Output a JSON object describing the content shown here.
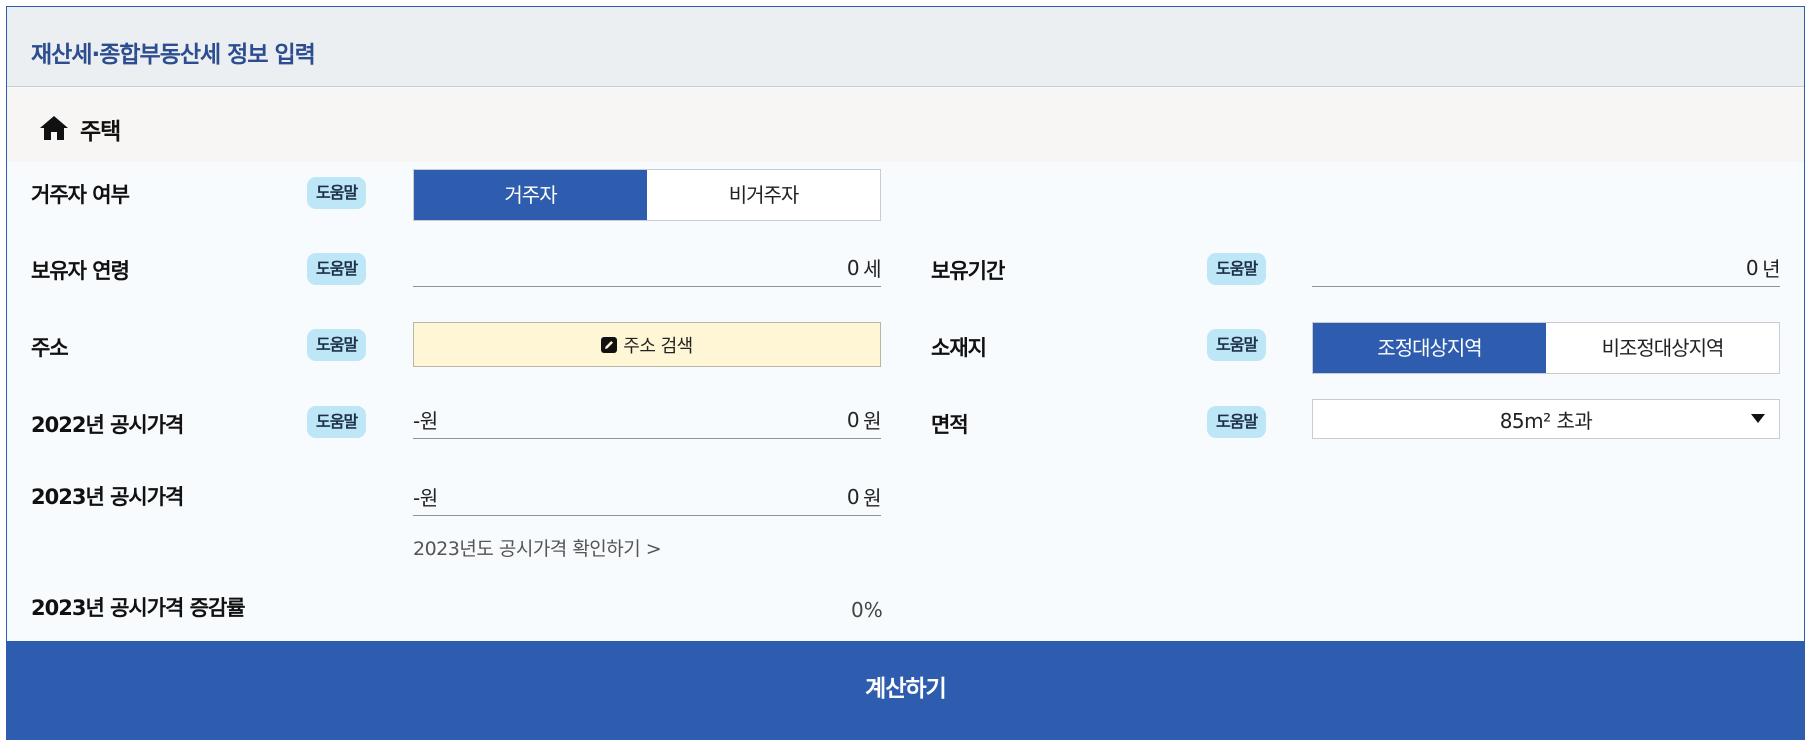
{
  "header": {
    "title": "재산세·종합부동산세 정보 입력"
  },
  "section": {
    "title": "주택",
    "icon": "house-icon"
  },
  "help_label": "도움말",
  "residency": {
    "label": "거주자 여부",
    "options": [
      "거주자",
      "비거주자"
    ],
    "selected": "거주자"
  },
  "owner_age": {
    "label": "보유자 연령",
    "value": "0",
    "unit": "세"
  },
  "holding_period": {
    "label": "보유기간",
    "value": "0",
    "unit": "년"
  },
  "address": {
    "label": "주소",
    "button_label": "주소 검색",
    "icon": "edit-icon"
  },
  "location": {
    "label": "소재지",
    "options": [
      "조정대상지역",
      "비조정대상지역"
    ],
    "selected": "조정대상지역"
  },
  "price_2022": {
    "label": "2022년 공시가격",
    "hint": "-원",
    "value": "0",
    "unit": "원"
  },
  "area": {
    "label": "면적",
    "selected": "85m² 초과",
    "icon": "caret-down-icon"
  },
  "price_2023": {
    "label": "2023년 공시가격",
    "hint": "-원",
    "value": "0",
    "unit": "원",
    "link": "2023년도 공시가격 확인하기 >"
  },
  "change_rate": {
    "label": "2023년 공시가격 증감률",
    "value": "0%"
  },
  "submit_label": "계산하기",
  "colors": {
    "primary": "#2e5cae",
    "help_badge": "#bde6f7",
    "search_bg": "#fff6d5",
    "title": "#2c4d90"
  }
}
